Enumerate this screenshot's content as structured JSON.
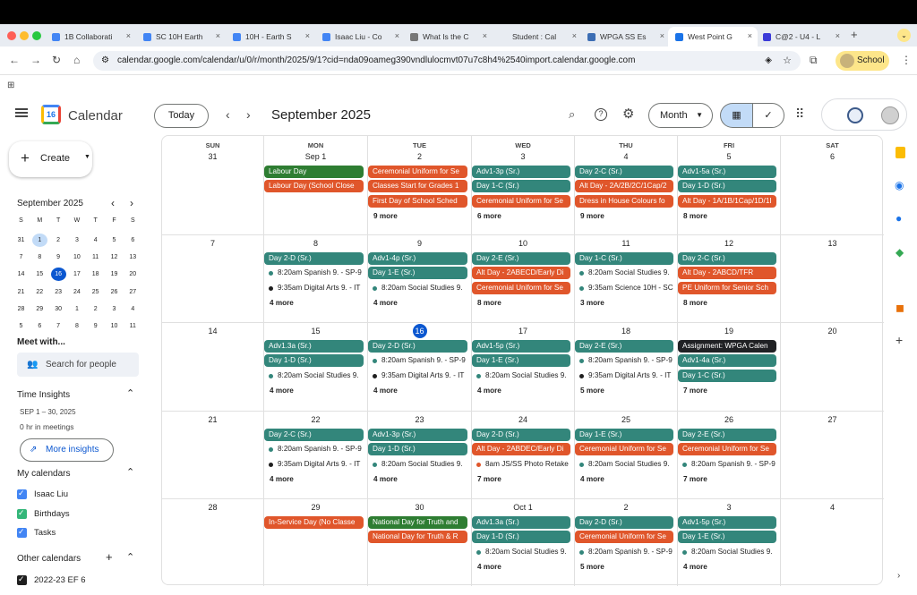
{
  "browser": {
    "tabs": [
      {
        "label": "1B Collaborati",
        "icon_color": "#4285f4"
      },
      {
        "label": "SC 10H Earth",
        "icon_color": "#4285f4"
      },
      {
        "label": "10H - Earth S",
        "icon_color": "#4285f4"
      },
      {
        "label": "Isaac Liu - Co",
        "icon_color": "#4285f4"
      },
      {
        "label": "What Is the C",
        "icon_color": "#777"
      },
      {
        "label": "Student : Cal",
        "icon_color": "#e8ecf2"
      },
      {
        "label": "WPGA SS Es",
        "icon_color": "#3c6eb4"
      },
      {
        "label": "West Point G",
        "icon_color": "#1a73e8"
      },
      {
        "label": "C@2 - U4 - L",
        "icon_color": "#3b3bd8"
      }
    ],
    "new_tab": "+",
    "url": "calendar.google.com/calendar/u/0/r/month/2025/9/1?cid=nda09oameg390vndlulocmvt07u7c8h4%2540import.calendar.google.com",
    "profile": "School"
  },
  "header": {
    "app_name": "Calendar",
    "logo_day": "16",
    "today_label": "Today",
    "month_title": "September 2025",
    "view_label": "Month"
  },
  "sidebar": {
    "create_label": "Create",
    "mini_month": "September 2025",
    "weekday_initials": [
      "S",
      "M",
      "T",
      "W",
      "T",
      "F",
      "S"
    ],
    "mini_days": [
      [
        "31",
        "1",
        "2",
        "3",
        "4",
        "5",
        "6"
      ],
      [
        "7",
        "8",
        "9",
        "10",
        "11",
        "12",
        "13"
      ],
      [
        "14",
        "15",
        "16",
        "17",
        "18",
        "19",
        "20"
      ],
      [
        "21",
        "22",
        "23",
        "24",
        "25",
        "26",
        "27"
      ],
      [
        "28",
        "29",
        "30",
        "1",
        "2",
        "3",
        "4"
      ],
      [
        "5",
        "6",
        "7",
        "8",
        "9",
        "10",
        "11"
      ]
    ],
    "meet_with": "Meet with...",
    "search_people": "Search for people",
    "time_insights": "Time Insights",
    "insights_range": "SEP 1 – 30, 2025",
    "insights_meetings": "0 hr in meetings",
    "more_insights": "More insights",
    "my_calendars": "My calendars",
    "my_calendar_items": [
      {
        "label": "Isaac Liu",
        "color": "#4285f4"
      },
      {
        "label": "Birthdays",
        "color": "#33b679"
      },
      {
        "label": "Tasks",
        "color": "#4285f4"
      }
    ],
    "other_calendars": "Other calendars",
    "other_calendar_items": [
      {
        "label": "2022-23 EF 6",
        "color": "#1f1f1f"
      }
    ]
  },
  "calendar": {
    "weekdays": [
      "SUN",
      "MON",
      "TUE",
      "WED",
      "THU",
      "FRI",
      "SAT"
    ],
    "colors": {
      "teal": "#33867b",
      "orange": "#e0562b",
      "green": "#2e7d32",
      "black": "#1f1f1f",
      "blue": "#1e6ed3",
      "dark": "#202124"
    },
    "weeks": [
      [
        {
          "day": "31",
          "events": []
        },
        {
          "day": "Sep 1",
          "events": [
            {
              "t": "Labour Day",
              "c": "green"
            },
            {
              "t": "Labour Day (School Close",
              "c": "orange"
            }
          ]
        },
        {
          "day": "2",
          "events": [
            {
              "t": "Ceremonial Uniform for Se",
              "c": "orange"
            },
            {
              "t": "Classes Start for Grades 1",
              "c": "orange"
            },
            {
              "t": "First Day of School Sched",
              "c": "orange"
            }
          ],
          "more": "9 more"
        },
        {
          "day": "3",
          "events": [
            {
              "t": "Adv1-3p (Sr.)",
              "c": "teal"
            },
            {
              "t": "Day 1-C (Sr.)",
              "c": "teal"
            },
            {
              "t": "Ceremonial Uniform for Se",
              "c": "orange"
            }
          ],
          "more": "6 more"
        },
        {
          "day": "4",
          "events": [
            {
              "t": "Day 2-C (Sr.)",
              "c": "teal"
            },
            {
              "t": "Alt Day - 2A/2B/2C/1Cap/2",
              "c": "orange"
            },
            {
              "t": "Dress in House Colours fo",
              "c": "orange"
            }
          ],
          "more": "9 more"
        },
        {
          "day": "5",
          "events": [
            {
              "t": "Adv1-5a (Sr.)",
              "c": "teal"
            },
            {
              "t": "Day 1-D (Sr.)",
              "c": "teal"
            },
            {
              "t": "Alt Day - 1A/1B/1Cap/1D/1I",
              "c": "orange"
            }
          ],
          "more": "8 more"
        },
        {
          "day": "6",
          "events": []
        }
      ],
      [
        {
          "day": "7",
          "events": []
        },
        {
          "day": "8",
          "events": [
            {
              "t": "Day 2-D (Sr.)",
              "c": "teal"
            },
            {
              "t": "8:20am Spanish 9. - SP-9",
              "d": "teal"
            },
            {
              "t": "9:35am Digital Arts 9. - IT",
              "d": "black"
            }
          ],
          "more": "4 more"
        },
        {
          "day": "9",
          "events": [
            {
              "t": "Adv1-4p (Sr.)",
              "c": "teal"
            },
            {
              "t": "Day 1-E (Sr.)",
              "c": "teal"
            },
            {
              "t": "8:20am Social Studies 9.",
              "d": "teal"
            }
          ],
          "more": "4 more"
        },
        {
          "day": "10",
          "events": [
            {
              "t": "Day 2-E (Sr.)",
              "c": "teal"
            },
            {
              "t": "Alt Day - 2ABECD/Early Di",
              "c": "orange"
            },
            {
              "t": "Ceremonial Uniform for Se",
              "c": "orange"
            }
          ],
          "more": "8 more"
        },
        {
          "day": "11",
          "events": [
            {
              "t": "Day 1-C (Sr.)",
              "c": "teal"
            },
            {
              "t": "8:20am Social Studies 9.",
              "d": "teal"
            },
            {
              "t": "9:35am Science 10H - SC",
              "d": "teal"
            }
          ],
          "more": "3 more"
        },
        {
          "day": "12",
          "events": [
            {
              "t": "Day 2-C (Sr.)",
              "c": "teal"
            },
            {
              "t": "Alt Day - 2ABCD/TFR",
              "c": "orange"
            },
            {
              "t": "PE Uniform for Senior Sch",
              "c": "orange"
            }
          ],
          "more": "8 more"
        },
        {
          "day": "13",
          "events": []
        }
      ],
      [
        {
          "day": "14",
          "events": []
        },
        {
          "day": "15",
          "events": [
            {
              "t": "Adv1.3a (Sr.)",
              "c": "teal"
            },
            {
              "t": "Day 1-D (Sr.)",
              "c": "teal"
            },
            {
              "t": "8:20am Social Studies 9.",
              "d": "teal"
            }
          ],
          "more": "4 more"
        },
        {
          "day": "16",
          "today": true,
          "events": [
            {
              "t": "Day 2-D (Sr.)",
              "c": "teal"
            },
            {
              "t": "8:20am Spanish 9. - SP-9",
              "d": "teal"
            },
            {
              "t": "9:35am Digital Arts 9. - IT",
              "d": "black"
            }
          ],
          "more": "4 more"
        },
        {
          "day": "17",
          "events": [
            {
              "t": "Adv1-5p (Sr.)",
              "c": "teal"
            },
            {
              "t": "Day 1-E (Sr.)",
              "c": "teal"
            },
            {
              "t": "8:20am Social Studies 9.",
              "d": "teal"
            }
          ],
          "more": "4 more"
        },
        {
          "day": "18",
          "events": [
            {
              "t": "Day 2-E (Sr.)",
              "c": "teal"
            },
            {
              "t": "8:20am Spanish 9. - SP-9",
              "d": "teal"
            },
            {
              "t": "9:35am Digital Arts 9. - IT",
              "d": "black"
            }
          ],
          "more": "5 more"
        },
        {
          "day": "19",
          "events": [
            {
              "t": "Assignment: WPGA Calen",
              "c": "dark"
            },
            {
              "t": "Adv1-4a (Sr.)",
              "c": "teal"
            },
            {
              "t": "Day 1-C (Sr.)",
              "c": "teal"
            }
          ],
          "more": "7 more"
        },
        {
          "day": "20",
          "events": []
        }
      ],
      [
        {
          "day": "21",
          "events": []
        },
        {
          "day": "22",
          "events": [
            {
              "t": "Day 2-C (Sr.)",
              "c": "teal"
            },
            {
              "t": "8:20am Spanish 9. - SP-9",
              "d": "teal"
            },
            {
              "t": "9:35am Digital Arts 9. - IT",
              "d": "black"
            }
          ],
          "more": "4 more"
        },
        {
          "day": "23",
          "events": [
            {
              "t": "Adv1-3p (Sr.)",
              "c": "teal"
            },
            {
              "t": "Day 1-D (Sr.)",
              "c": "teal"
            },
            {
              "t": "8:20am Social Studies 9.",
              "d": "teal"
            }
          ],
          "more": "4 more"
        },
        {
          "day": "24",
          "events": [
            {
              "t": "Day 2-D (Sr.)",
              "c": "teal"
            },
            {
              "t": "Alt Day - 2ABDEC/Early Di",
              "c": "orange"
            },
            {
              "t": "8am JS/SS Photo Retake",
              "d": "orange"
            }
          ],
          "more": "7 more"
        },
        {
          "day": "25",
          "events": [
            {
              "t": "Day 1-E (Sr.)",
              "c": "teal"
            },
            {
              "t": "Ceremonial Uniform for Se",
              "c": "orange"
            },
            {
              "t": "8:20am Social Studies 9.",
              "d": "teal"
            }
          ],
          "more": "4 more"
        },
        {
          "day": "26",
          "events": [
            {
              "t": "Day 2-E (Sr.)",
              "c": "teal"
            },
            {
              "t": "Ceremonial Uniform for Se",
              "c": "orange"
            },
            {
              "t": "8:20am Spanish 9. - SP-9",
              "d": "teal"
            }
          ],
          "more": "7 more"
        },
        {
          "day": "27",
          "events": []
        }
      ],
      [
        {
          "day": "28",
          "events": []
        },
        {
          "day": "29",
          "events": [
            {
              "t": "In-Service Day (No Classe",
              "c": "orange"
            }
          ]
        },
        {
          "day": "30",
          "events": [
            {
              "t": "National Day for Truth and",
              "c": "green"
            },
            {
              "t": "National Day for Truth & R",
              "c": "orange"
            }
          ]
        },
        {
          "day": "Oct 1",
          "events": [
            {
              "t": "Adv1.3a (Sr.)",
              "c": "teal"
            },
            {
              "t": "Day 1-D (Sr.)",
              "c": "teal"
            },
            {
              "t": "8:20am Social Studies 9.",
              "d": "teal"
            }
          ],
          "more": "4 more"
        },
        {
          "day": "2",
          "events": [
            {
              "t": "Day 2-D (Sr.)",
              "c": "teal"
            },
            {
              "t": "Ceremonial Uniform for Se",
              "c": "orange"
            },
            {
              "t": "8:20am Spanish 9. - SP-9",
              "d": "teal"
            }
          ],
          "more": "5 more"
        },
        {
          "day": "3",
          "events": [
            {
              "t": "Adv1-5p (Sr.)",
              "c": "teal"
            },
            {
              "t": "Day 1-E (Sr.)",
              "c": "teal"
            },
            {
              "t": "8:20am Social Studies 9.",
              "d": "teal"
            }
          ],
          "more": "4 more"
        },
        {
          "day": "4",
          "events": []
        }
      ]
    ]
  }
}
